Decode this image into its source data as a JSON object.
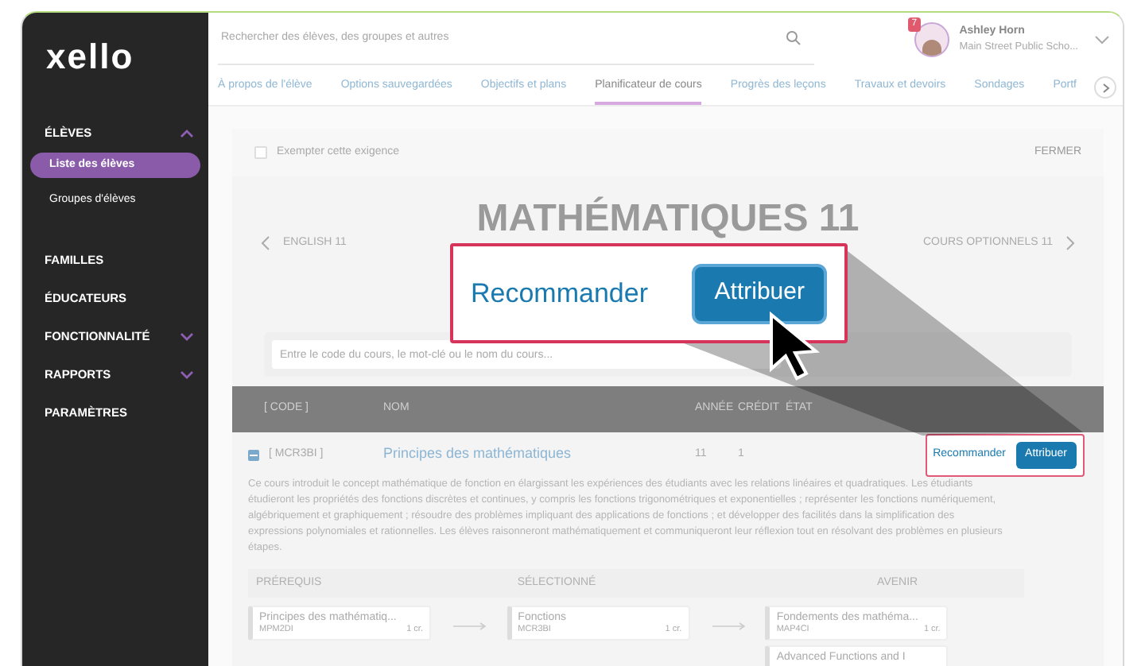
{
  "sidebar": {
    "logo": "xello",
    "items": [
      {
        "label": "ÉLÈVES",
        "expanded": true,
        "children": [
          {
            "label": "Liste des élèves",
            "selected": true
          },
          {
            "label": "Groupes d'élèves",
            "selected": false
          }
        ]
      },
      {
        "label": "FAMILLES"
      },
      {
        "label": "ÉDUCATEURS"
      },
      {
        "label": "FONCTIONNALITÉ",
        "expanded": false
      },
      {
        "label": "RAPPORTS",
        "expanded": false
      },
      {
        "label": "PARAMÈTRES"
      }
    ]
  },
  "header": {
    "search": {
      "placeholder": "Rechercher des élèves, des groupes et autres"
    },
    "user": {
      "badge": "7",
      "name": "Ashley Horn",
      "school": "Main Street Public Scho..."
    },
    "tabs": [
      {
        "label": "À propos de l'élève",
        "selected": false
      },
      {
        "label": "Options sauvegardées",
        "selected": false
      },
      {
        "label": "Objectifs et plans",
        "selected": false
      },
      {
        "label": "Planificateur de cours",
        "selected": true
      },
      {
        "label": "Progrès des leçons",
        "selected": false
      },
      {
        "label": "Travaux et devoirs",
        "selected": false
      },
      {
        "label": "Sondages",
        "selected": false
      },
      {
        "label": "Portf",
        "selected": false
      }
    ]
  },
  "card": {
    "exempt": {
      "label": "Exempter cette exigence",
      "checked": false
    },
    "close": "FERMER",
    "nav": {
      "previous": "ENGLISH 11",
      "title": "MATHÉMATIQUES 11",
      "next": "COURS OPTIONNELS 11"
    },
    "course_search": {
      "placeholder": "Entre le code du cours, le mot-clé ou le nom du cours..."
    },
    "table": {
      "columns": [
        "[ CODE ]",
        "NOM",
        "ANNÉE",
        "CRÉDIT",
        "ÉTAT"
      ],
      "rows": [
        {
          "expanded": true,
          "code": "[ MCR3BI ]",
          "name": "Principes des mathématiques",
          "year": "11",
          "credit": "1",
          "actions": [
            "Recommander",
            "Attribuer"
          ],
          "description": "Ce cours introduit le concept mathématique de fonction en élargissant les expériences des étudiants avec les relations linéaires et quadratiques. Les étudiants étudieront les propriétés des fonctions discrètes et continues, y compris les fonctions trigonométriques et exponentielles ; représenter les fonctions numériquement, algébriquement et graphiquement ; résoudre des problèmes impliquant des applications de fonctions ; et développer des facilités dans la simplification des expressions polynomiales et rationnelles. Les élèves raisonneront mathématiquement et communiqueront leur réflexion tout en résolvant des problèmes en plusieurs étapes."
        }
      ]
    },
    "pathway": {
      "columns": [
        {
          "title": "PRÉREQUIS",
          "courses": [
            {
              "name": "Principes des mathématiq...",
              "code": "MPM2DI",
              "credit": "1 cr."
            }
          ]
        },
        {
          "title": "SÉLECTIONNÉ",
          "courses": [
            {
              "name": "Fonctions",
              "code": "MCR3BI",
              "credit": "1 cr."
            }
          ]
        },
        {
          "title": "AVENIR",
          "courses": [
            {
              "name": "Fondements des mathéma...",
              "code": "MAP4CI",
              "credit": "1 cr."
            },
            {
              "name": "Advanced Functions and I"
            }
          ]
        }
      ]
    }
  },
  "callout": {
    "secondary": "Recommander",
    "primary": "Attribuer"
  }
}
